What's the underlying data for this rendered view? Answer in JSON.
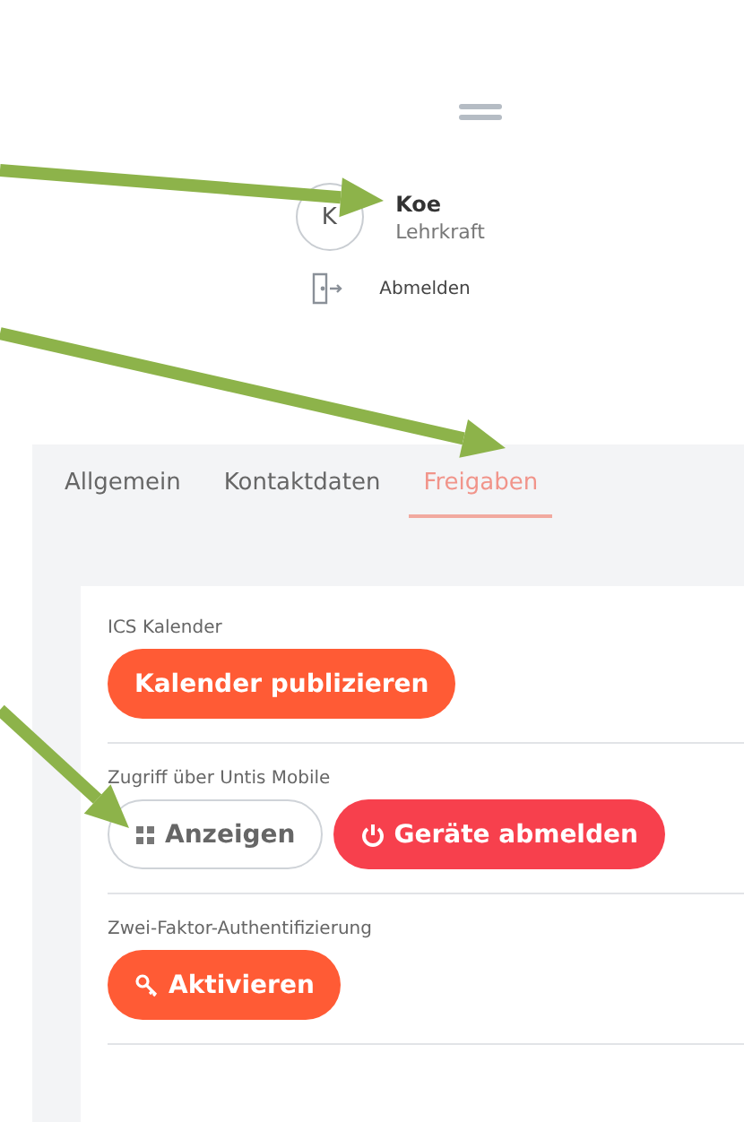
{
  "user": {
    "initial": "K",
    "name": "Koe",
    "role": "Lehrkraft",
    "logout": "Abmelden"
  },
  "tabs": [
    {
      "label": "Allgemein",
      "selected": false
    },
    {
      "label": "Kontaktdaten",
      "selected": false
    },
    {
      "label": "Freigaben",
      "selected": true
    }
  ],
  "sections": [
    {
      "label": "ICS Kalender",
      "buttons": [
        {
          "label": "Kalender publizieren",
          "kind": "primary"
        }
      ]
    },
    {
      "label": "Zugriff über Untis Mobile",
      "buttons": [
        {
          "label": "Anzeigen",
          "kind": "outline"
        },
        {
          "label": "Geräte abmelden",
          "kind": "danger"
        }
      ]
    },
    {
      "label": "Zwei-Faktor-Authentifizierung",
      "buttons": [
        {
          "label": "Aktivieren",
          "kind": "primary"
        }
      ]
    }
  ]
}
